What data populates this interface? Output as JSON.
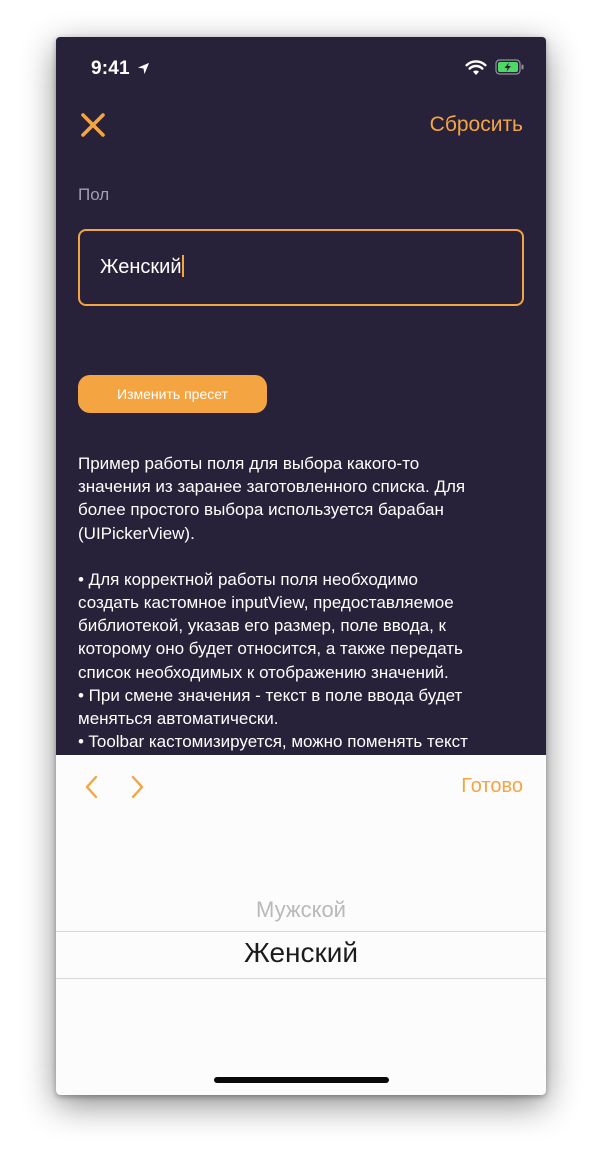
{
  "status_bar": {
    "time": "9:41"
  },
  "nav": {
    "reset_label": "Сбросить"
  },
  "form": {
    "field_label": "Пол",
    "field_value": "Женский",
    "preset_button_label": "Изменить пресет"
  },
  "description": {
    "lines": [
      "Пример работы поля для выбора какого-то",
      "значения из заранее заготовленного списка. Для",
      "более простого выбора используется барабан",
      "(UIPickerView).",
      "",
      "• Для корректной работы поля необходимо",
      "создать кастомное inputView, предоставляемое",
      "библиотекой, указав его размер, поле ввода, к",
      "которому оно будет относится, а также передать",
      "список необходимых к отображению значений.",
      "• При смене значения - текст в поле ввода будет",
      "меняться автоматически.",
      "• Toolbar кастомизируется, можно поменять текст"
    ]
  },
  "toolbar": {
    "done_label": "Готово"
  },
  "picker": {
    "options": [
      "Мужской",
      "Женский"
    ],
    "selected": "Женский"
  },
  "colors": {
    "accent": "#f5a442",
    "background": "#272239"
  },
  "icons": [
    "location-arrow-icon",
    "wifi-icon",
    "battery-charging-icon",
    "close-icon",
    "chevron-left-icon",
    "chevron-right-icon"
  ]
}
